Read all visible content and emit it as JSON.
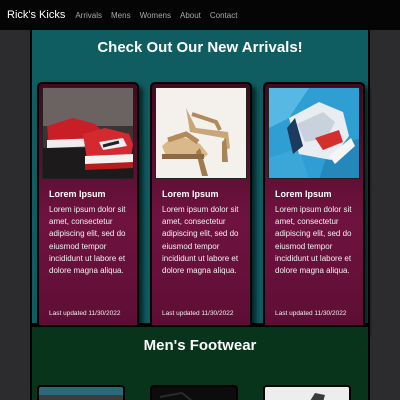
{
  "navbar": {
    "brand": "Rick's Kicks",
    "links": [
      "Arrivals",
      "Mens",
      "Womens",
      "About",
      "Contact"
    ]
  },
  "arrivals": {
    "title": "Check Out Our New Arrivals!",
    "cards": [
      {
        "title": "Lorem Ipsum",
        "text": "Lorem ipsum dolor sit amet, consectetur adipiscing elit, sed do eiusmod tempor incididunt ut labore et dolore magna aliqua.",
        "footer": "Last updated 11/30/2022"
      },
      {
        "title": "Lorem Ipsum",
        "text": "Lorem ipsum dolor sit amet, consectetur adipiscing elit, sed do eiusmod tempor incididunt ut labore et dolore magna aliqua.",
        "footer": "Last updated 11/30/2022"
      },
      {
        "title": "Lorem Ipsum",
        "text": "Lorem ipsum dolor sit amet, consectetur adipiscing elit, sed do eiusmod tempor incididunt ut labore et dolore magna aliqua.",
        "footer": "Last updated 11/30/2022"
      }
    ]
  },
  "mens": {
    "title": "Men's Footwear"
  },
  "colors": {
    "navbar": "#050505",
    "arrivals_bg": "#0f5c61",
    "mens_bg": "#07341b",
    "card_bg": "#6f1240"
  }
}
